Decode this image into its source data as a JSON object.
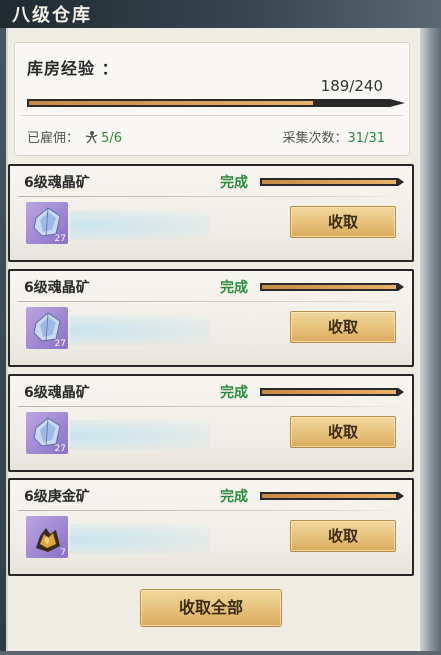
{
  "window": {
    "title": "八级仓库"
  },
  "summary": {
    "exp_label": "库房经验 ：",
    "exp_value": "189/240",
    "exp_progress": 0.7875,
    "employed_label": "已雇佣：",
    "employed_value": "5/6",
    "gather_label": "采集次数：",
    "gather_value": "31/31"
  },
  "mines": [
    {
      "name": "6级魂晶矿",
      "status": "完成",
      "progress": 1.0,
      "item_icon": "soul-crystal-icon",
      "item_count": "27",
      "button": "收取"
    },
    {
      "name": "6级魂晶矿",
      "status": "完成",
      "progress": 1.0,
      "item_icon": "soul-crystal-icon",
      "item_count": "27",
      "button": "收取"
    },
    {
      "name": "6级魂晶矿",
      "status": "完成",
      "progress": 1.0,
      "item_icon": "soul-crystal-icon",
      "item_count": "27",
      "button": "收取"
    },
    {
      "name": "6级庚金矿",
      "status": "完成",
      "progress": 1.0,
      "item_icon": "geng-gold-ore-icon",
      "item_count": "7",
      "button": "收取"
    }
  ],
  "footer": {
    "collect_all_label": "收取全部"
  },
  "colors": {
    "status_green": "#2d8a3e",
    "button_gold": "#e6c07a",
    "bar_fill": "#d9a35a"
  }
}
